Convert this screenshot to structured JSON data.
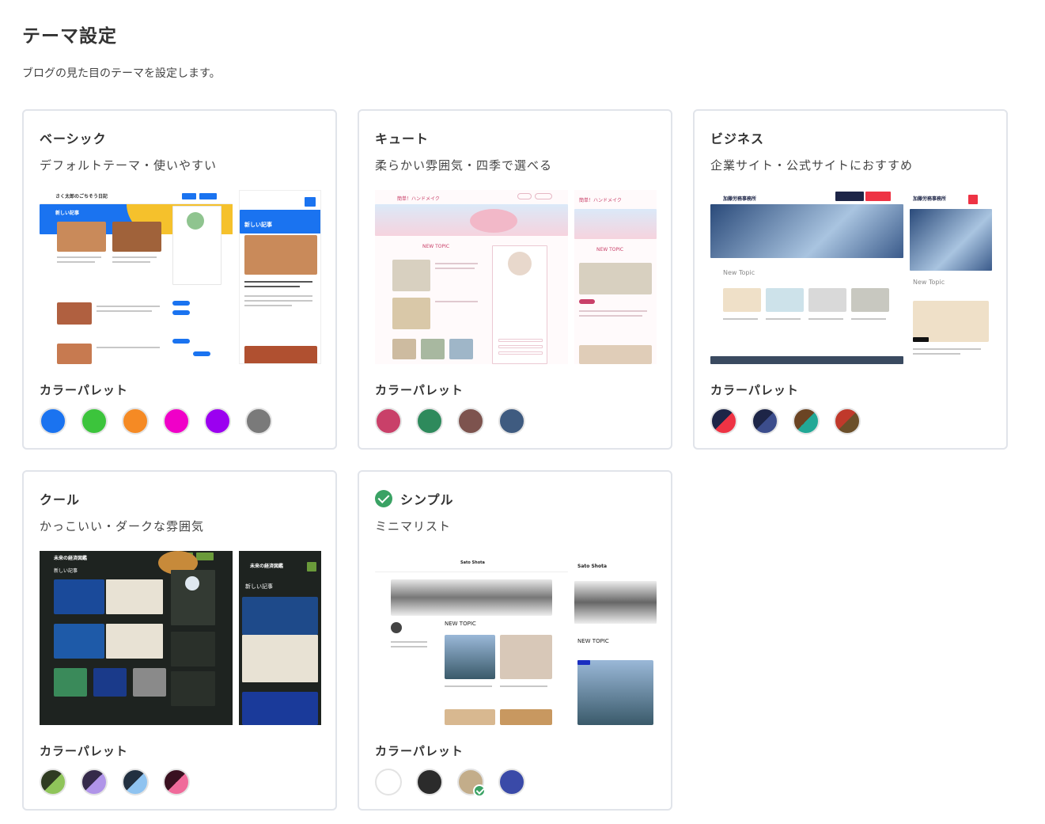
{
  "page": {
    "title": "テーマ設定",
    "description": "ブログの見た目のテーマを設定します。"
  },
  "palette_label": "カラーパレット",
  "themes": [
    {
      "name": "ベーシック",
      "description": "デフォルトテーマ・使いやすい",
      "selected": false,
      "preview_text": {
        "site_title": "さく太郎のごちそう日記",
        "section": "新しい記事",
        "mobile_section": "新しい記事"
      },
      "swatches": [
        {
          "colors": [
            "#1a73f0"
          ]
        },
        {
          "colors": [
            "#3cc43c"
          ]
        },
        {
          "colors": [
            "#f58a24"
          ]
        },
        {
          "colors": [
            "#f000c8"
          ]
        },
        {
          "colors": [
            "#9b00f0"
          ]
        },
        {
          "colors": [
            "#7a7a7a"
          ]
        }
      ]
    },
    {
      "name": "キュート",
      "description": "柔らかい雰囲気・四季で選べる",
      "selected": false,
      "preview_text": {
        "site_title": "簡単！ハンドメイク",
        "section": "NEW TOPIC",
        "mobile_section": "NEW TOPIC"
      },
      "swatches": [
        {
          "colors": [
            "#c94069"
          ]
        },
        {
          "colors": [
            "#2e8a5c"
          ]
        },
        {
          "colors": [
            "#7d534e"
          ]
        },
        {
          "colors": [
            "#3f5b80"
          ]
        }
      ]
    },
    {
      "name": "ビジネス",
      "description": "企業サイト・公式サイトにおすすめ",
      "selected": false,
      "preview_text": {
        "site_title": "加藤労務事務所",
        "section": "New Topic",
        "mobile_section": "New Topic"
      },
      "swatches": [
        {
          "colors": [
            "#1d2547",
            "#ee3344"
          ]
        },
        {
          "colors": [
            "#1d2547",
            "#3c4d8c"
          ]
        },
        {
          "colors": [
            "#6b4423",
            "#22a896"
          ]
        },
        {
          "colors": [
            "#c0392b",
            "#6b4f2a"
          ]
        }
      ]
    },
    {
      "name": "クール",
      "description": "かっこいい・ダークな雰囲気",
      "selected": false,
      "preview_text": {
        "site_title": "未来の経済図鑑",
        "section": "新しい記事",
        "mobile_section": "新しい記事"
      },
      "swatches": [
        {
          "colors": [
            "#2f3b22",
            "#8fc45a"
          ]
        },
        {
          "colors": [
            "#352a4a",
            "#b094e8"
          ]
        },
        {
          "colors": [
            "#223040",
            "#8fc3f0"
          ]
        },
        {
          "colors": [
            "#3a1020",
            "#f06a9a"
          ]
        }
      ]
    },
    {
      "name": "シンプル",
      "description": "ミニマリスト",
      "selected": true,
      "preview_text": {
        "site_title": "Sato Shota",
        "section": "NEW TOPIC",
        "mobile_section": "NEW TOPIC"
      },
      "swatches": [
        {
          "colors": [
            "#ffffff"
          ]
        },
        {
          "colors": [
            "#2b2b2b"
          ]
        },
        {
          "colors": [
            "#c3ad8a"
          ],
          "selected": true
        },
        {
          "colors": [
            "#3a4aa8"
          ]
        }
      ]
    }
  ]
}
